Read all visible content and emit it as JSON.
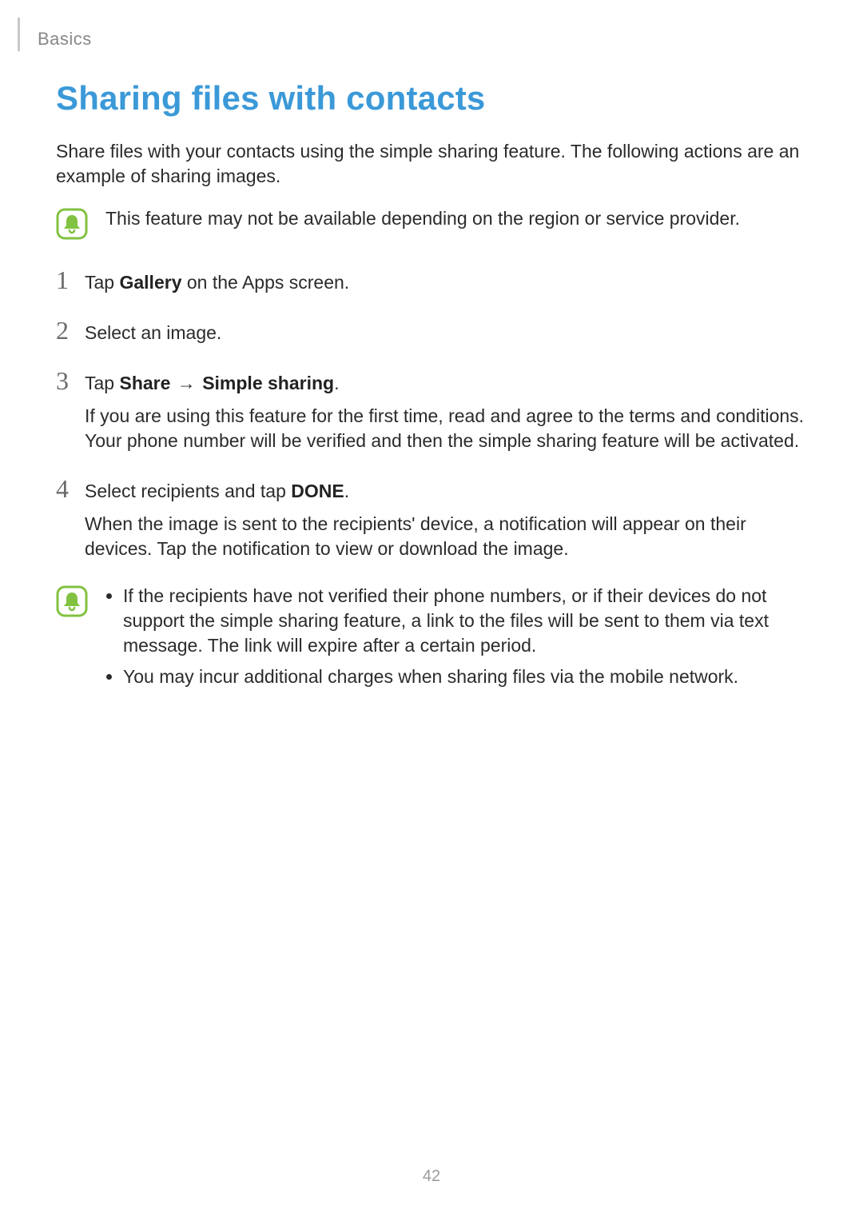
{
  "header": {
    "breadcrumb": "Basics"
  },
  "title": "Sharing files with contacts",
  "intro": "Share files with your contacts using the simple sharing feature. The following actions are an example of sharing images.",
  "note1": {
    "icon": "bell-note-icon",
    "text": "This feature may not be available depending on the region or service provider."
  },
  "steps": [
    {
      "num": "1",
      "line_pre": "Tap ",
      "bold1": "Gallery",
      "line_post": " on the Apps screen."
    },
    {
      "num": "2",
      "line": "Select an image."
    },
    {
      "num": "3",
      "line_pre": "Tap ",
      "bold1": "Share",
      "arrow": " → ",
      "bold2": "Simple sharing",
      "line_post": ".",
      "sub": "If you are using this feature for the first time, read and agree to the terms and conditions. Your phone number will be verified and then the simple sharing feature will be activated."
    },
    {
      "num": "4",
      "line_pre": "Select recipients and tap ",
      "bold1": "DONE",
      "line_post": ".",
      "sub": "When the image is sent to the recipients' device, a notification will appear on their devices. Tap the notification to view or download the image."
    }
  ],
  "note2": {
    "icon": "bell-note-icon",
    "bullets": [
      "If the recipients have not verified their phone numbers, or if their devices do not support the simple sharing feature, a link to the files will be sent to them via text message. The link will expire after a certain period.",
      "You may incur additional charges when sharing files via the mobile network."
    ]
  },
  "page_number": "42"
}
